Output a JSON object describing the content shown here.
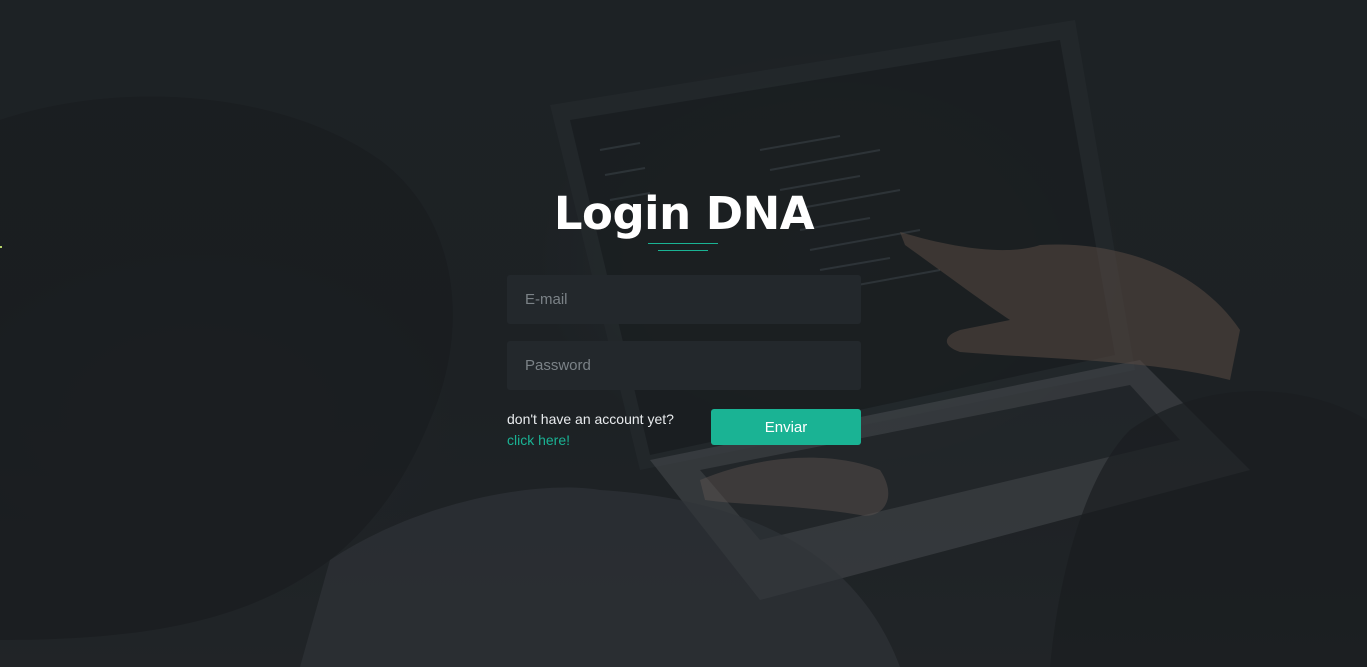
{
  "page": {
    "title": "Login DNA",
    "accent_color": "#1ab394",
    "background_description_icon": "laptop-background-image"
  },
  "form": {
    "email_placeholder": "E-mail",
    "email_value": "",
    "password_placeholder": "Password",
    "password_value": "",
    "submit_label": "Enviar"
  },
  "signup": {
    "prompt": "don't have an account yet?",
    "link_label": "click here!"
  }
}
